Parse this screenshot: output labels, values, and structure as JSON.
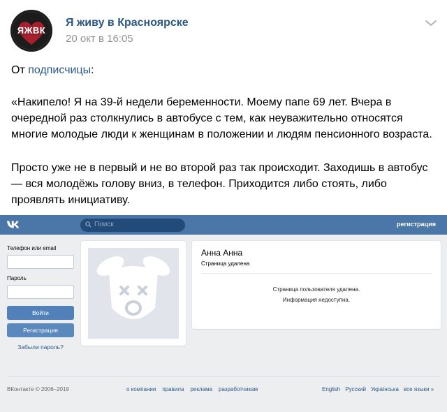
{
  "post": {
    "group_name": "Я живу в Красноярске",
    "date": "20 окт в 16:05",
    "avatar_text": "ЯЖВК",
    "from_prefix": "От ",
    "from_link": "подписчицы",
    "from_suffix": ":",
    "paragraph1": "«Накипело! Я на 39-й недели беременности. Моему папе 69 лет. Вчера в очередной раз столкнулись в автобусе с тем, как неуважительно относятся многие молодые люди к женщинам в положении и людям пенсионного возраста.",
    "paragraph2": "Просто уже не в первый и не во второй раз так происходит. Заходишь в автобус — вся молодёжь голову вниз, в телефон. Приходится либо стоять, либо проявлять инициативу."
  },
  "vk": {
    "header": {
      "search_placeholder": "Поиск",
      "register_link": "регистрация"
    },
    "login": {
      "phone_label": "Телефон или email",
      "password_label": "Пароль",
      "login_button": "Войти",
      "register_button": "Регистрация",
      "forgot_link": "Забыли пароль?"
    },
    "profile": {
      "name": "Анна Анна",
      "status": "Страница удалена",
      "deleted_line1": "Страница пользователя удалена.",
      "deleted_line2": "Информация недоступна."
    },
    "footer": {
      "copyright": "ВКонтакте © 2006–2019",
      "links": [
        "о компании",
        "правила",
        "реклама",
        "разработчикам"
      ],
      "languages": [
        "English",
        "Русский",
        "Українська",
        "все языки »"
      ]
    },
    "colors": {
      "header_bg": "#4a76a8",
      "button_bg": "#5181b8",
      "link": "#2a5885",
      "page_bg": "#edeef0"
    }
  }
}
